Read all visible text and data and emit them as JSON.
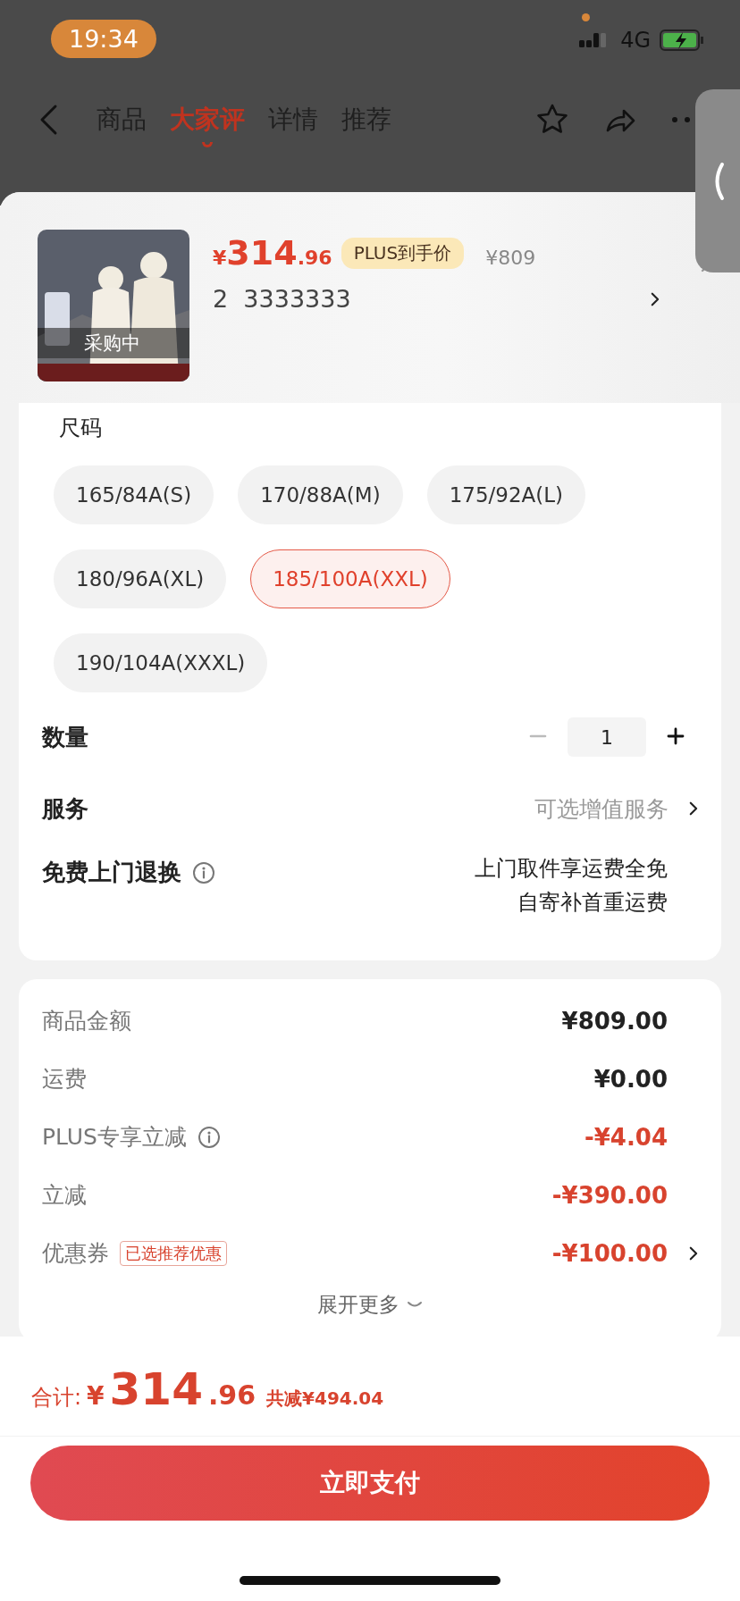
{
  "status_bar": {
    "time": "19:34",
    "network": "4G"
  },
  "nav": {
    "tabs": [
      {
        "label": "商品",
        "selected": false
      },
      {
        "label": "大家评",
        "selected": true
      },
      {
        "label": "详情",
        "selected": false
      },
      {
        "label": "推荐",
        "selected": false
      }
    ]
  },
  "product": {
    "image_badge": "采购中",
    "currency": "¥",
    "price_int": "314",
    "price_dec": ".96",
    "price_badge": "PLUS到手价",
    "original_price": "¥809",
    "spec": "2  3333333"
  },
  "sizes": {
    "title": "尺码",
    "options": [
      {
        "label": "165/84A(S)",
        "selected": false
      },
      {
        "label": "170/88A(M)",
        "selected": false
      },
      {
        "label": "175/92A(L)",
        "selected": false
      },
      {
        "label": "180/96A(XL)",
        "selected": false
      },
      {
        "label": "185/100A(XXL)",
        "selected": true
      },
      {
        "label": "190/104A(XXXL)",
        "selected": false
      }
    ]
  },
  "quantity": {
    "label": "数量",
    "value": "1",
    "decrement_disabled": true
  },
  "service": {
    "label": "服务",
    "value": "可选增值服务"
  },
  "return_service": {
    "label": "免费上门退换",
    "lines": [
      "上门取件享运费全免",
      "自寄补首重运费"
    ]
  },
  "summary": {
    "rows": [
      {
        "label": "商品金额",
        "value": "¥809.00",
        "kind": "plain",
        "info": false,
        "chevron": false
      },
      {
        "label": "运费",
        "value": "¥0.00",
        "kind": "plain",
        "info": false,
        "chevron": false
      },
      {
        "label": "PLUS专享立减",
        "value": "-¥4.04",
        "kind": "discount",
        "info": true,
        "chevron": false
      },
      {
        "label": "立减",
        "value": "-¥390.00",
        "kind": "discount",
        "info": false,
        "chevron": false
      },
      {
        "label": "优惠券",
        "tag": "已选推荐优惠",
        "value": "-¥100.00",
        "kind": "discount",
        "info": false,
        "chevron": true
      }
    ],
    "expand": "展开更多"
  },
  "total": {
    "label": "合计:",
    "currency": "¥",
    "int": "314",
    "dec": ".96",
    "saved": "共减¥494.04"
  },
  "pay_button": "立即支付"
}
